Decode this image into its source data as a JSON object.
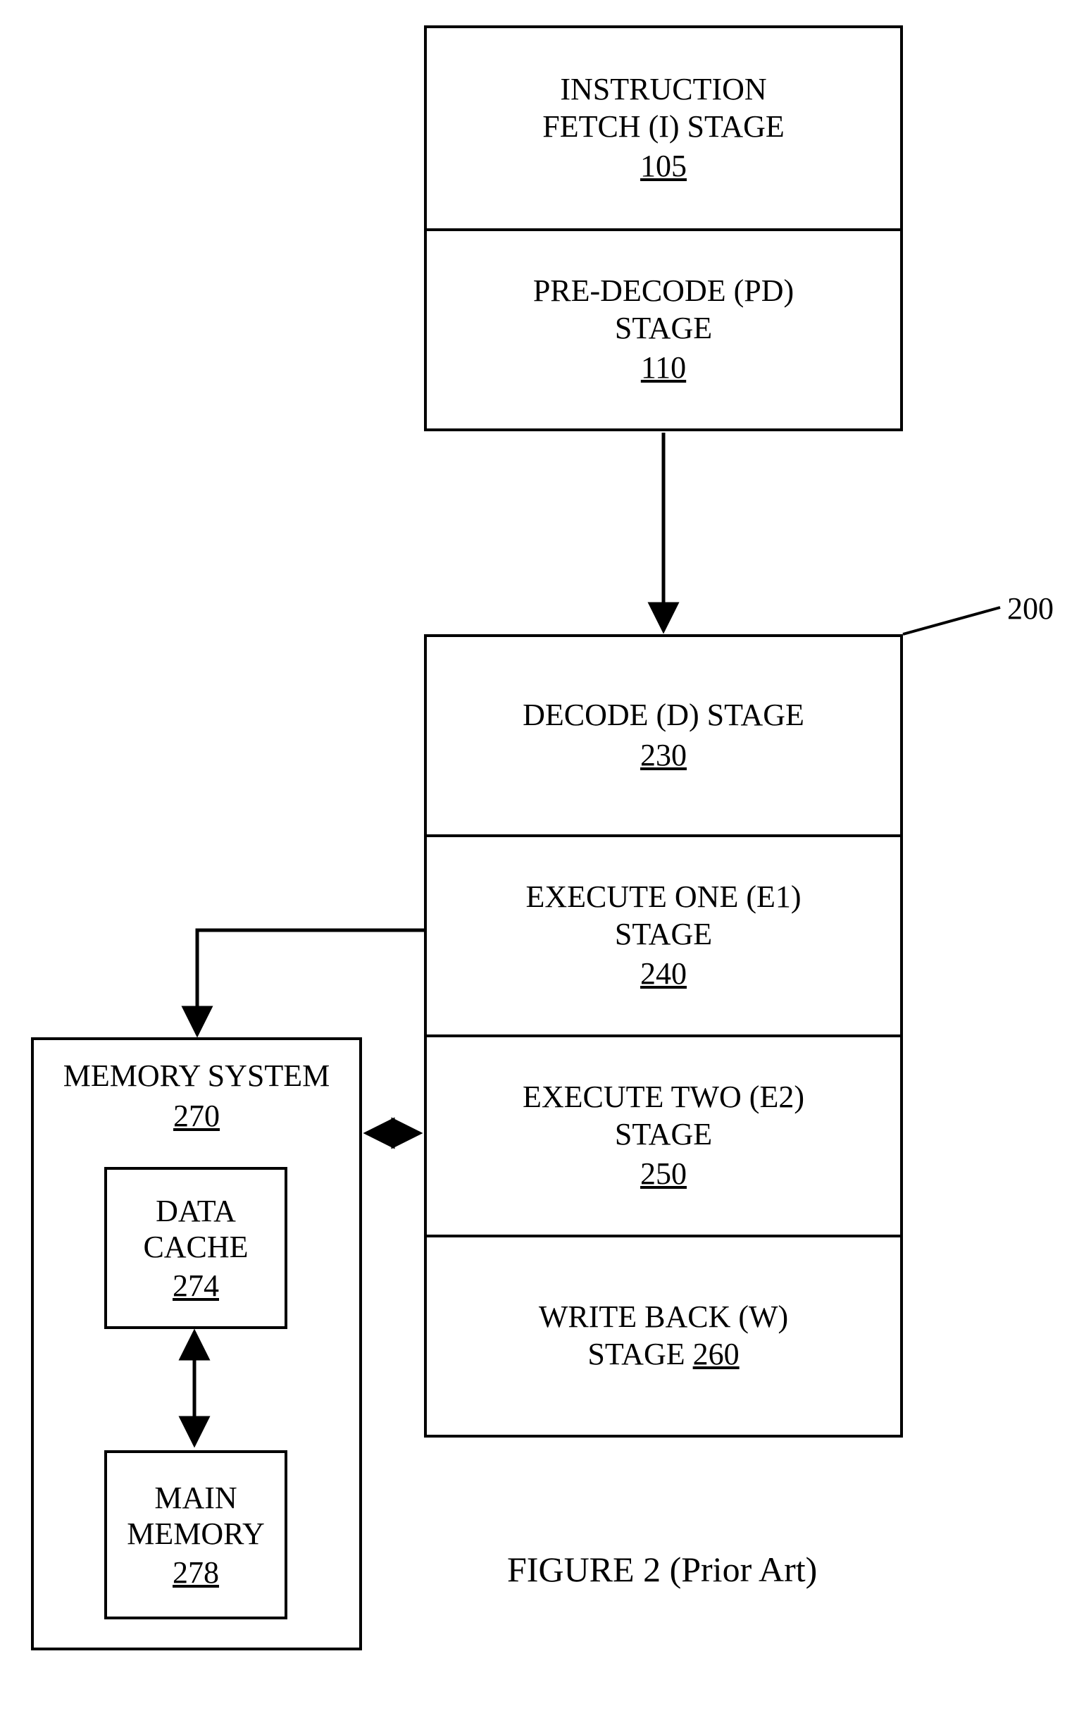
{
  "top_block": {
    "stage_i": {
      "line1": "INSTRUCTION",
      "line2": "FETCH (I) STAGE",
      "ref": "105"
    },
    "stage_pd": {
      "line1": "PRE-DECODE (PD)",
      "line2": "STAGE",
      "ref": "110"
    }
  },
  "pipeline": {
    "ref_label": "200",
    "stage_d": {
      "line1": "DECODE (D) STAGE",
      "ref": "230"
    },
    "stage_e1": {
      "line1": "EXECUTE ONE (E1)",
      "line2": "STAGE",
      "ref": "240"
    },
    "stage_e2": {
      "line1": "EXECUTE TWO (E2)",
      "line2": "STAGE",
      "ref": "250"
    },
    "stage_w": {
      "line1": "WRITE BACK (W)",
      "line2_prefix": "STAGE",
      "ref": "260"
    }
  },
  "memory": {
    "title": "MEMORY SYSTEM",
    "ref": "270",
    "data_cache": {
      "line1": "DATA",
      "line2": "CACHE",
      "ref": "274"
    },
    "main_memory": {
      "line1": "MAIN",
      "line2": "MEMORY",
      "ref": "278"
    }
  },
  "caption": "FIGURE 2 (Prior Art)"
}
